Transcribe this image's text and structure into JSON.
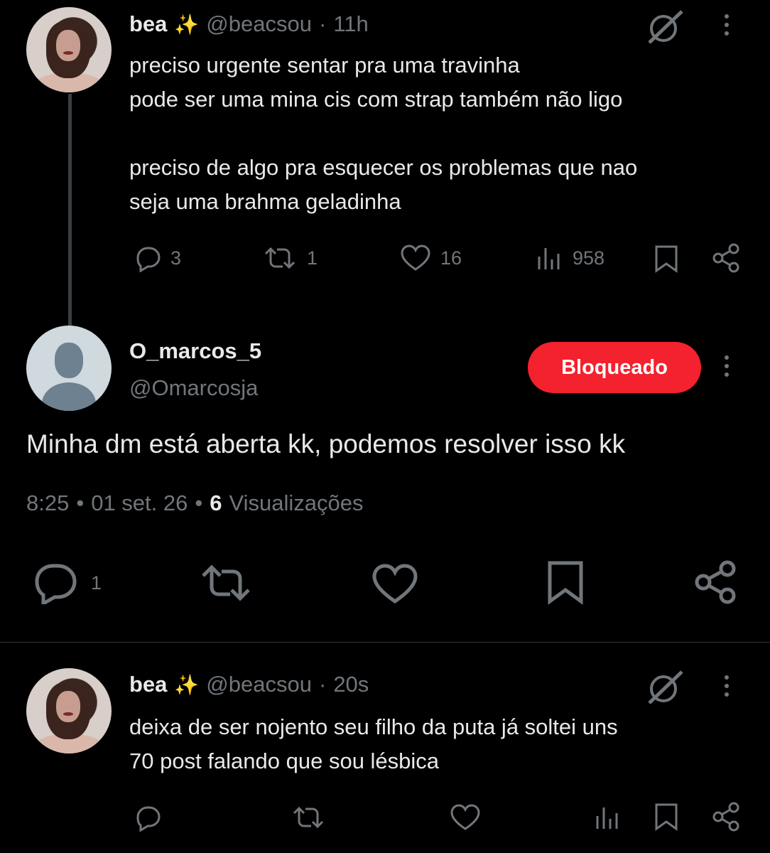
{
  "post1": {
    "name": "bea",
    "emoji": "✨",
    "handle": "@beacsou",
    "dot": "·",
    "time": "11h",
    "lines": [
      "preciso urgente sentar pra uma travinha",
      "pode ser uma mina cis com strap também não ligo",
      "",
      "preciso de algo pra esquecer os problemas que nao",
      "seja uma brahma geladinha"
    ],
    "replies": "3",
    "reposts": "1",
    "likes": "16",
    "views": "958"
  },
  "main": {
    "name": "O_marcos_5",
    "handle": "@Omarcosja",
    "block_label": "Bloqueado",
    "text": "Minha dm está aberta kk, podemos resolver isso kk",
    "meta_time": "8:25",
    "meta_sep1": "•",
    "meta_date": "01 set. 26",
    "meta_sep2": "•",
    "meta_views_count": "6",
    "meta_views_label": "Visualizações",
    "replies": "1"
  },
  "post2": {
    "name": "bea",
    "emoji": "✨",
    "handle": "@beacsou",
    "dot": "·",
    "time": "20s",
    "lines": [
      "deixa de ser nojento seu filho da puta já soltei uns",
      "70 post falando que sou lésbica"
    ]
  },
  "icons": {
    "reply": "reply-icon",
    "repost": "repost-icon",
    "like": "heart-icon",
    "views": "views-icon",
    "bookmark": "bookmark-icon",
    "share": "share-icon",
    "grok": "grok-icon",
    "more": "more-icon"
  }
}
